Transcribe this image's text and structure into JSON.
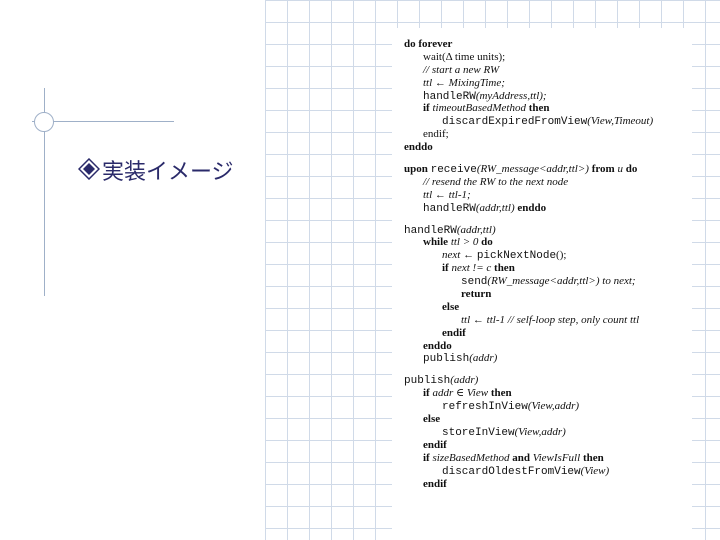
{
  "slide": {
    "title": "実装イメージ"
  },
  "code": [
    {
      "indent": 0,
      "parts": [
        {
          "t": "do forever",
          "s": "kw"
        }
      ]
    },
    {
      "indent": 1,
      "parts": [
        {
          "t": "wait(Δ time units);",
          "s": ""
        }
      ]
    },
    {
      "indent": 1,
      "parts": [
        {
          "t": "// start a new RW",
          "s": "it"
        }
      ]
    },
    {
      "indent": 1,
      "parts": [
        {
          "t": "ttl ← MixingTime;",
          "s": "it"
        }
      ]
    },
    {
      "indent": 1,
      "parts": [
        {
          "t": "handleRW",
          "s": "tt"
        },
        {
          "t": "(myAddress,ttl);",
          "s": "it"
        }
      ]
    },
    {
      "indent": 1,
      "parts": [
        {
          "t": "if ",
          "s": "kw"
        },
        {
          "t": "timeoutBasedMethod",
          "s": "it"
        },
        {
          "t": " then",
          "s": "kw"
        }
      ]
    },
    {
      "indent": 2,
      "parts": [
        {
          "t": "discardExpiredFromView",
          "s": "tt"
        },
        {
          "t": "(View,Timeout)",
          "s": "it"
        }
      ]
    },
    {
      "indent": 1,
      "parts": [
        {
          "t": "endif;",
          "s": ""
        }
      ]
    },
    {
      "indent": 0,
      "parts": [
        {
          "t": "enddo",
          "s": "kw"
        }
      ]
    },
    {
      "gap": true
    },
    {
      "indent": 0,
      "parts": [
        {
          "t": "upon ",
          "s": "kw"
        },
        {
          "t": "receive",
          "s": "tt"
        },
        {
          "t": "(RW_message<addr,ttl>) ",
          "s": "it"
        },
        {
          "t": "from ",
          "s": "kw"
        },
        {
          "t": "u ",
          "s": "it"
        },
        {
          "t": "do",
          "s": "kw"
        }
      ]
    },
    {
      "indent": 1,
      "parts": [
        {
          "t": "// resend the RW to the next node",
          "s": "it"
        }
      ]
    },
    {
      "indent": 1,
      "parts": [
        {
          "t": "ttl ← ttl-1;",
          "s": "it"
        }
      ]
    },
    {
      "indent": 1,
      "parts": [
        {
          "t": "handleRW",
          "s": "tt"
        },
        {
          "t": "(addr,ttl) ",
          "s": "it"
        },
        {
          "t": "enddo",
          "s": "kw"
        }
      ]
    },
    {
      "gap": true
    },
    {
      "indent": 0,
      "parts": [
        {
          "t": "handleRW",
          "s": "tt"
        },
        {
          "t": "(addr,ttl)",
          "s": "it"
        }
      ]
    },
    {
      "indent": 1,
      "parts": [
        {
          "t": "while ",
          "s": "kw"
        },
        {
          "t": "ttl > 0 ",
          "s": "it"
        },
        {
          "t": "do",
          "s": "kw"
        }
      ]
    },
    {
      "indent": 2,
      "parts": [
        {
          "t": "next ← ",
          "s": "it"
        },
        {
          "t": "pickNextNode",
          "s": "tt"
        },
        {
          "t": "();",
          "s": ""
        }
      ]
    },
    {
      "indent": 2,
      "parts": [
        {
          "t": "if ",
          "s": "kw"
        },
        {
          "t": "next != c ",
          "s": "it"
        },
        {
          "t": "then",
          "s": "kw"
        }
      ]
    },
    {
      "indent": 3,
      "parts": [
        {
          "t": "send",
          "s": "tt"
        },
        {
          "t": "(RW_message<addr,ttl>) to next;",
          "s": "it"
        }
      ]
    },
    {
      "indent": 3,
      "parts": [
        {
          "t": "return",
          "s": "kw"
        }
      ]
    },
    {
      "indent": 2,
      "parts": [
        {
          "t": "else",
          "s": "kw"
        }
      ]
    },
    {
      "indent": 3,
      "parts": [
        {
          "t": "ttl ← ttl-1 // self-loop step, only count ttl",
          "s": "it"
        }
      ]
    },
    {
      "indent": 2,
      "parts": [
        {
          "t": "endif",
          "s": "kw"
        }
      ]
    },
    {
      "indent": 1,
      "parts": [
        {
          "t": "enddo",
          "s": "kw"
        }
      ]
    },
    {
      "indent": 1,
      "parts": [
        {
          "t": "publish",
          "s": "tt"
        },
        {
          "t": "(addr)",
          "s": "it"
        }
      ]
    },
    {
      "gap": true
    },
    {
      "indent": 0,
      "parts": [
        {
          "t": "publish",
          "s": "tt"
        },
        {
          "t": "(addr)",
          "s": "it"
        }
      ]
    },
    {
      "indent": 1,
      "parts": [
        {
          "t": "if ",
          "s": "kw"
        },
        {
          "t": "addr ∈ View ",
          "s": "it"
        },
        {
          "t": "then",
          "s": "kw"
        }
      ]
    },
    {
      "indent": 2,
      "parts": [
        {
          "t": "refreshInView",
          "s": "tt"
        },
        {
          "t": "(View,addr)",
          "s": "it"
        }
      ]
    },
    {
      "indent": 1,
      "parts": [
        {
          "t": "else",
          "s": "kw"
        }
      ]
    },
    {
      "indent": 2,
      "parts": [
        {
          "t": "storeInView",
          "s": "tt"
        },
        {
          "t": "(View,addr)",
          "s": "it"
        }
      ]
    },
    {
      "indent": 1,
      "parts": [
        {
          "t": "endif",
          "s": "kw"
        }
      ]
    },
    {
      "indent": 1,
      "parts": [
        {
          "t": "if ",
          "s": "kw"
        },
        {
          "t": "sizeBasedMethod",
          "s": "it"
        },
        {
          "t": " and ",
          "s": "kw"
        },
        {
          "t": "ViewIsFull",
          "s": "it"
        },
        {
          "t": " then",
          "s": "kw"
        }
      ]
    },
    {
      "indent": 2,
      "parts": [
        {
          "t": "discardOldestFromView",
          "s": "tt"
        },
        {
          "t": "(View)",
          "s": "it"
        }
      ]
    },
    {
      "indent": 1,
      "parts": [
        {
          "t": "endif",
          "s": "kw"
        }
      ]
    }
  ]
}
